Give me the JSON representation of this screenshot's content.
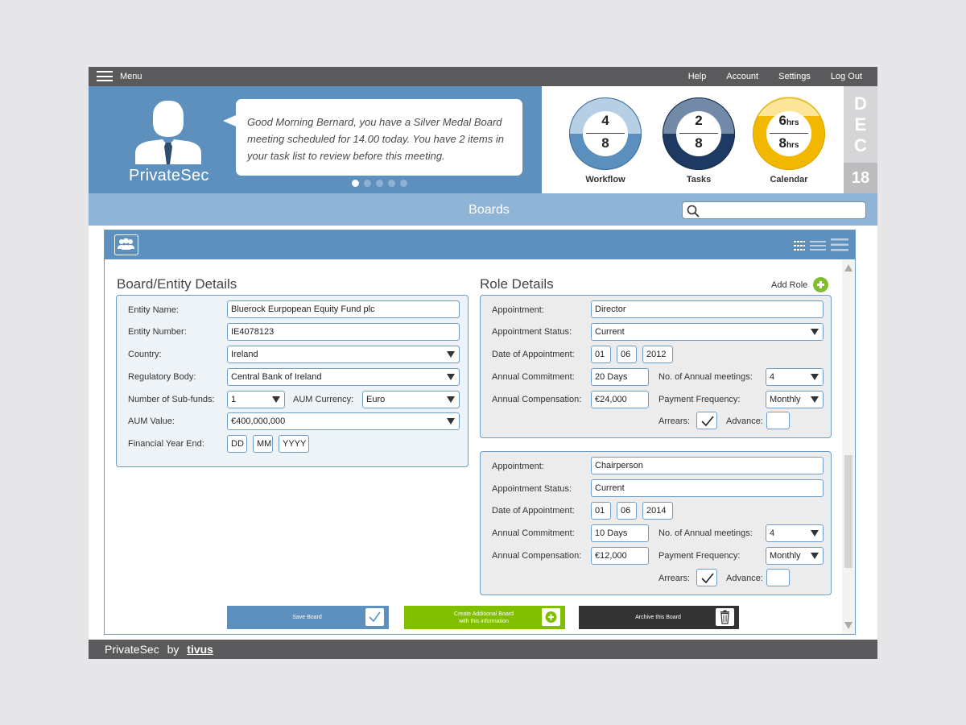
{
  "topbar": {
    "menu_label": "Menu",
    "links": [
      "Help",
      "Account",
      "Settings",
      "Log Out"
    ]
  },
  "hero": {
    "brand": "PrivateSec",
    "message": "Good Morning Bernard, you have a Silver Medal Board meeting scheduled for 14.00 today. You have 2 items in your task list to review before this meeting.",
    "carousel_count": 5,
    "carousel_active": 1
  },
  "stats": {
    "workflow": {
      "label": "Workflow",
      "top": "4",
      "bottom": "8",
      "color": "#5b8fbe",
      "light": "#b6cfe5"
    },
    "tasks": {
      "label": "Tasks",
      "top": "2",
      "bottom": "8",
      "color": "#1e3a63",
      "light": "#7389a8"
    },
    "calendar": {
      "label": "Calendar",
      "top": "6",
      "top_unit": "hrs",
      "bottom": "8",
      "bottom_unit": "hrs",
      "color": "#f2b800",
      "light": "#fde69a"
    }
  },
  "date": {
    "month_letters": [
      "D",
      "E",
      "C"
    ],
    "day": "18"
  },
  "section": {
    "title": "Boards",
    "search_placeholder": ""
  },
  "entity": {
    "heading": "Board/Entity Details",
    "labels": {
      "name": "Entity Name:",
      "number": "Entity Number:",
      "country": "Country:",
      "regulatory": "Regulatory Body:",
      "subfunds": "Number of Sub-funds:",
      "currency": "AUM Currency:",
      "aum": "AUM Value:",
      "fye": "Financial Year End:"
    },
    "values": {
      "name": "Bluerock Eurpopean Equity Fund plc",
      "number": "IE4078123",
      "country": "Ireland",
      "regulatory": "Central Bank of Ireland",
      "subfunds": "1",
      "currency": "Euro",
      "aum": "€400,000,000",
      "fye_dd": "DD",
      "fye_mm": "MM",
      "fye_yyyy": "YYYY"
    }
  },
  "roles": {
    "heading": "Role Details",
    "add_label": "Add Role",
    "labels": {
      "appointment": "Appointment:",
      "status": "Appointment Status:",
      "date": "Date of Appointment:",
      "commitment": "Annual Commitment:",
      "meetings": "No. of Annual meetings:",
      "compensation": "Annual Compensation:",
      "frequency": "Payment Frequency:",
      "arrears": "Arrears:",
      "advance": "Advance:"
    },
    "items": [
      {
        "appointment": "Director",
        "status": "Current",
        "dd": "01",
        "mm": "06",
        "yyyy": "2012",
        "commitment": "20 Days",
        "meetings": "4",
        "compensation": "€24,000",
        "frequency": "Monthly",
        "arrears": true,
        "advance": false
      },
      {
        "appointment": "Chairperson",
        "status": "Current",
        "dd": "01",
        "mm": "06",
        "yyyy": "2014",
        "commitment": "10 Days",
        "meetings": "4",
        "compensation": "€12,000",
        "frequency": "Monthly",
        "arrears": true,
        "advance": false
      }
    ]
  },
  "actions": {
    "save": "Save Board",
    "create_line1": "Create Additional Board",
    "create_line2": "with this information",
    "archive": "Archive this Board"
  },
  "footer": {
    "brand": "PrivateSec",
    "by": "by",
    "company": "tivus"
  },
  "colors": {
    "accent": "#5d90bd",
    "green": "#7fbf2c",
    "dark": "#333333"
  }
}
